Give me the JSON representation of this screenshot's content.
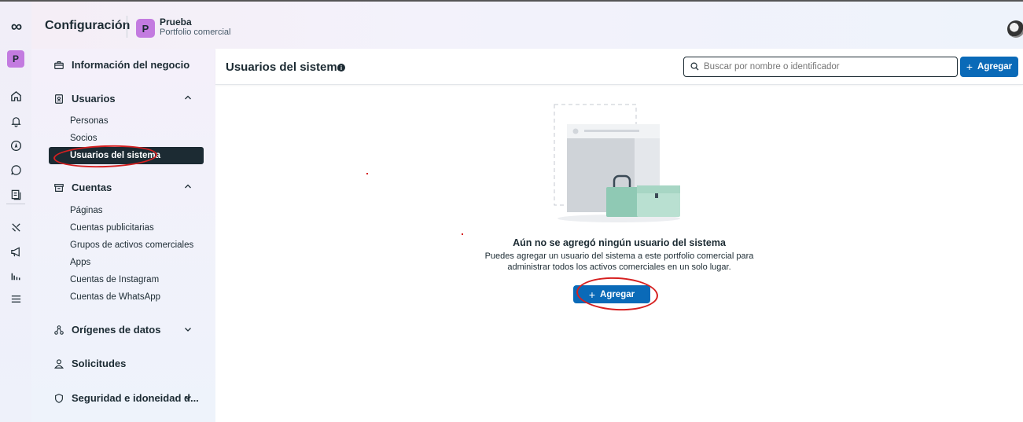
{
  "header": {
    "title": "Configuración",
    "portfolio_initial": "P",
    "portfolio_name": "Prueba",
    "portfolio_type": "Portfolio comercial"
  },
  "rail": {
    "portfolio_initial": "P",
    "icons": [
      "meta-logo-icon",
      "home-icon",
      "bell-icon",
      "compass-icon",
      "chat-icon",
      "pages-icon",
      "tools-icon",
      "megaphone-icon",
      "insights-icon",
      "menu-icon"
    ]
  },
  "sidebar": {
    "business_info": "Información del negocio",
    "users": {
      "label": "Usuarios",
      "items": [
        "Personas",
        "Socios",
        "Usuarios del sistema"
      ]
    },
    "accounts": {
      "label": "Cuentas",
      "items": [
        "Páginas",
        "Cuentas publicitarias",
        "Grupos de activos comerciales",
        "Apps",
        "Cuentas de Instagram",
        "Cuentas de WhatsApp"
      ]
    },
    "data_sources": "Orígenes de datos",
    "requests": "Solicitudes",
    "security": "Seguridad e idoneidad d..."
  },
  "main": {
    "title": "Usuarios del sistema",
    "search_placeholder": "Buscar por nombre o identificador",
    "add_label": "Agregar",
    "empty_title": "Aún no se agregó ningún usuario del sistema",
    "empty_desc_line1": "Puedes agregar un usuario del sistema a este portfolio comercial para",
    "empty_desc_line2": "administrar todos los activos comerciales en un solo lugar.",
    "empty_add_label": "Agregar"
  },
  "colors": {
    "primary_button": "#0a6ab8",
    "active_nav": "#1c2b33",
    "annotation": "#d62020",
    "portfolio_badge": "#c37be0"
  }
}
